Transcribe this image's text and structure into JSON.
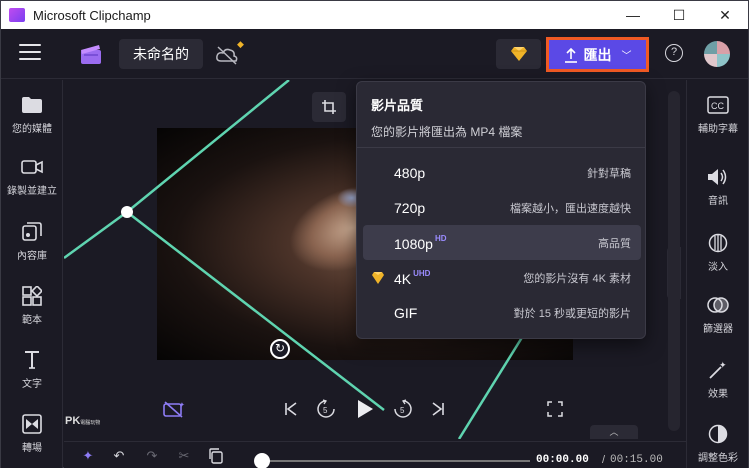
{
  "window": {
    "title": "Microsoft Clipchamp",
    "minimize": "—",
    "maximize": "☐",
    "close": "✕"
  },
  "topbar": {
    "project_name": "未命名的",
    "export_label": "匯出",
    "help": "?"
  },
  "sidebar_left": [
    {
      "label": "您的媒體",
      "icon": "folder-icon"
    },
    {
      "label": "錄製並建立",
      "icon": "camera-icon"
    },
    {
      "label": "內容庫",
      "icon": "library-icon"
    },
    {
      "label": "範本",
      "icon": "templates-icon"
    },
    {
      "label": "文字",
      "icon": "text-icon"
    },
    {
      "label": "轉場",
      "icon": "transitions-icon"
    }
  ],
  "sidebar_right": [
    {
      "label": "輔助字幕",
      "icon": "captions-icon"
    },
    {
      "label": "音訊",
      "icon": "audio-icon"
    },
    {
      "label": "淡入",
      "icon": "fade-icon"
    },
    {
      "label": "篩選器",
      "icon": "filters-icon"
    },
    {
      "label": "效果",
      "icon": "effects-icon"
    },
    {
      "label": "調整色彩",
      "icon": "color-icon"
    }
  ],
  "export_menu": {
    "title": "影片品質",
    "subtitle": "您的影片將匯出為 MP4 檔案",
    "options": [
      {
        "label": "480p",
        "badge": "",
        "desc": "針對草稿",
        "premium": false,
        "selected": false
      },
      {
        "label": "720p",
        "badge": "",
        "desc": "檔案越小，匯出速度越快",
        "premium": false,
        "selected": false
      },
      {
        "label": "1080p",
        "badge": "HD",
        "desc": "高品質",
        "premium": false,
        "selected": true
      },
      {
        "label": "4K",
        "badge": "UHD",
        "desc": "您的影片沒有 4K 素材",
        "premium": true,
        "selected": false
      },
      {
        "label": "GIF",
        "badge": "",
        "desc": "對於 15 秒或更短的影片",
        "premium": false,
        "selected": false
      }
    ]
  },
  "watermark": {
    "text": "PK",
    "small": "電腦玩物"
  },
  "timeline": {
    "current_time": "00:00.00",
    "separator": "/",
    "total_time": "00:15.00",
    "progress": 0
  },
  "colors": {
    "accent": "#5b49e6",
    "highlight_border": "#f05a24",
    "selection_frame": "#5fd4b0",
    "premium_gem": "#f0b429"
  }
}
